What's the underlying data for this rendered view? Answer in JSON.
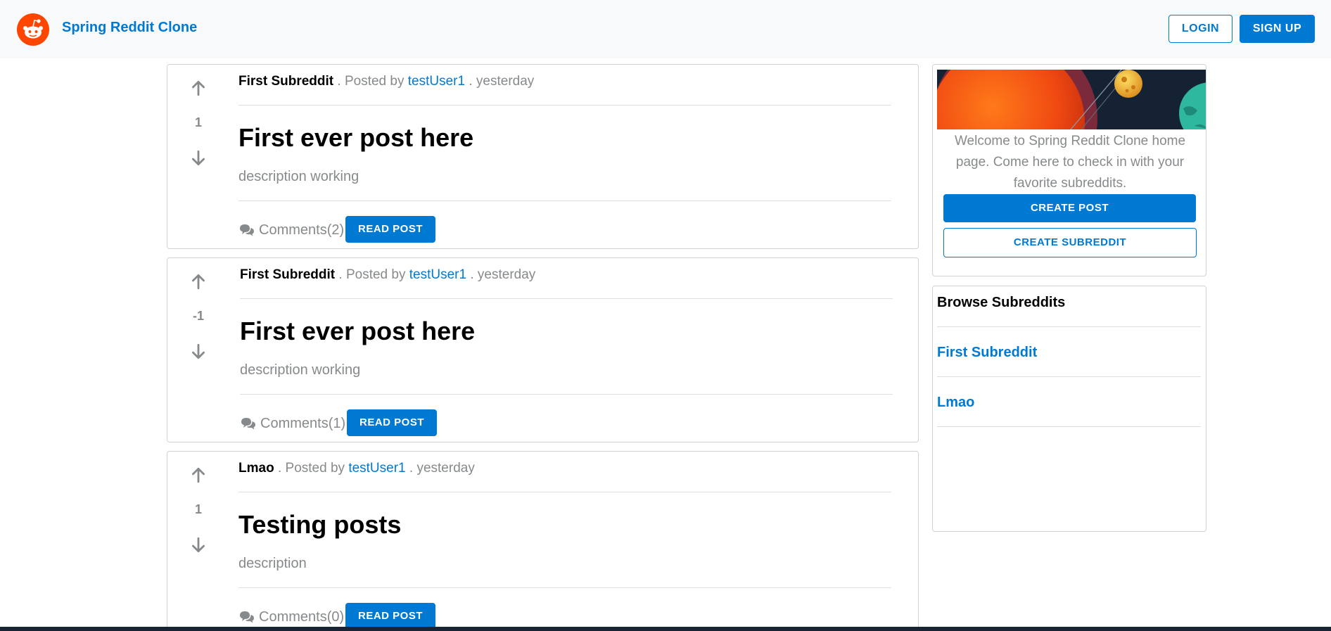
{
  "header": {
    "brand": "Spring Reddit Clone",
    "login_label": "LOGIN",
    "signup_label": "SIGN UP"
  },
  "posts": [
    {
      "subreddit": "First Subreddit",
      "posted_by_text": ". Posted by",
      "user": "testUser1",
      "time_text": ". yesterday",
      "votes": "1",
      "title": "First ever post here",
      "description": "description working",
      "comments": "Comments(2)",
      "read_label": "READ POST"
    },
    {
      "subreddit": "First Subreddit",
      "posted_by_text": ". Posted by",
      "user": "testUser1",
      "time_text": ". yesterday",
      "votes": "-1",
      "title": "First ever post here",
      "description": "description working",
      "comments": "Comments(1)",
      "read_label": "READ POST"
    },
    {
      "subreddit": "Lmao",
      "posted_by_text": ". Posted by",
      "user": "testUser1",
      "time_text": ". yesterday",
      "votes": "1",
      "title": "Testing posts",
      "description": "description",
      "comments": "Comments(0)",
      "read_label": "READ POST"
    }
  ],
  "sidebar": {
    "welcome_text": "Welcome to Spring Reddit Clone home page. Come here to check in with your favorite subreddits.",
    "create_post_label": "CREATE POST",
    "create_subreddit_label": "CREATE SUBREDDIT",
    "browse_title": "Browse Subreddits",
    "subreddits": [
      "First Subreddit",
      "Lmao"
    ]
  },
  "colors": {
    "accent": "#0079d3",
    "logo": "#ff4500",
    "muted_text": "#878a8c",
    "navbar_bg": "#f8f9fa"
  },
  "icons": {
    "logo": "reddit-alien-icon",
    "upvote": "arrow-up-icon",
    "downvote": "arrow-down-icon",
    "comments": "comments-icon"
  }
}
